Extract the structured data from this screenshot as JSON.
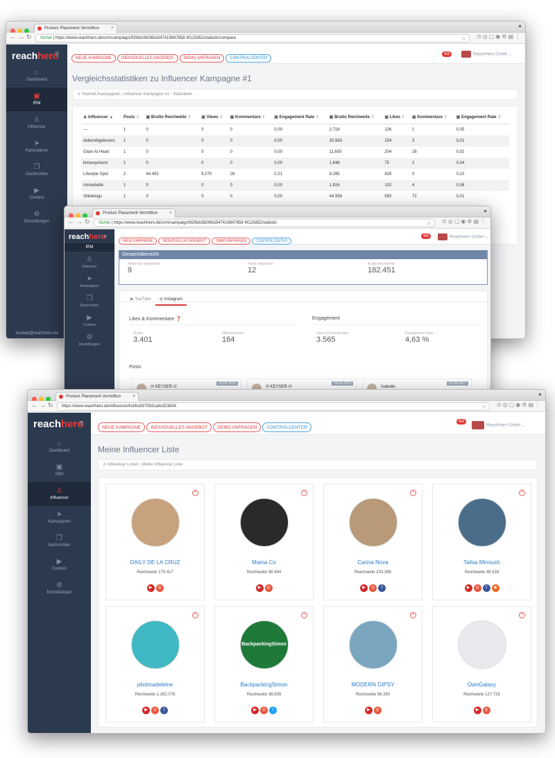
{
  "win1": {
    "tab_title": "Product Placement Vermittlun",
    "url_secure": "Sicher",
    "url": "https://www.reachhero.de/crm/campaign/92fddc5b065d347419847858 4f123d52/statistic/compare",
    "page_title": "Vergleichsstatistiken zu Influencer Kampagne #1",
    "breadcrumb": [
      "Statistik-Kampagnen",
      "Influencer Kampagne #1",
      "Statistiken"
    ],
    "sidebar": [
      {
        "label": "Dashboard",
        "icon": "home-icon"
      },
      {
        "label": "IRM",
        "icon": "briefcase-icon"
      },
      {
        "label": "Influencer",
        "icon": "user-icon"
      },
      {
        "label": "Kampagnen",
        "icon": "paper-plane-icon"
      },
      {
        "label": "Nachrichten",
        "icon": "chat-icon"
      },
      {
        "label": "Content",
        "icon": "video-icon"
      },
      {
        "label": "Einstellungen",
        "icon": "gear-icon"
      }
    ],
    "footer_email": "kontakt@reachhero.de",
    "table_headers": [
      "Influencer",
      "Posts",
      "Brutto Reichweite",
      "Views",
      "Kommentare",
      "Engagement Rate",
      "Brutto Reichweite",
      "Likes",
      "Kommentare",
      "Engagement Rate"
    ],
    "rows": [
      [
        "---",
        "1",
        "0",
        "0",
        "0",
        "0,00",
        "2.718",
        "126",
        "1",
        "0,05"
      ],
      [
        "deborahgebruers",
        "1",
        "0",
        "0",
        "0",
        "0,00",
        "20.563",
        "254",
        "3",
        "0,01"
      ],
      [
        "Glam At Heart",
        "1",
        "0",
        "0",
        "0",
        "0,00",
        "11.605",
        "204",
        "26",
        "0,02"
      ],
      [
        "kimwuyckens",
        "1",
        "0",
        "0",
        "0",
        "0,00",
        "1.846",
        "75",
        "2",
        "0,04"
      ],
      [
        "Lifestyle Spot",
        "2",
        "44.492",
        "9.270",
        "26",
        "0.21",
        "8.285",
        "828",
        "0",
        "0,10"
      ],
      [
        "minnebelle",
        "1",
        "0",
        "0",
        "0",
        "0,00",
        "1.816",
        "102",
        "4",
        "0,06"
      ],
      [
        "Silkeblogs",
        "1",
        "0",
        "0",
        "0",
        "0,00",
        "44.936",
        "593",
        "72",
        "0,01"
      ]
    ]
  },
  "common": {
    "pills": [
      "NEUE KAMPAGNE",
      "INDIVIDUELLES ANGEBOT",
      "DEMO ANFRAGEN",
      "CONTROLCENTER"
    ],
    "notif": "402",
    "account": "ReachHero GmbH",
    "brand_a": "reach",
    "brand_b": "hero"
  },
  "win2": {
    "tab_title": "Product Placement Vermittlun",
    "url_secure": "Sicher",
    "url": "https://www.reachhero.de/crm/campaign/92fddc5b065d347419847858 4f123d52/statistic",
    "sidebar_active": "IRM",
    "sidebar": [
      {
        "label": "Influencer",
        "icon": "user-icon"
      },
      {
        "label": "Kampagnen",
        "icon": "paper-plane-icon"
      },
      {
        "label": "Nachrichten",
        "icon": "chat-icon"
      },
      {
        "label": "Content",
        "icon": "video-icon"
      },
      {
        "label": "Einstellungen",
        "icon": "gear-icon"
      }
    ],
    "overview_title": "Gesamtübersicht",
    "overview_stats": [
      {
        "label": "Influencer eingesetzt",
        "value": "9"
      },
      {
        "label": "Posts eingesetzt",
        "value": "12"
      },
      {
        "label": "Brutto Reichweite",
        "value": "182.451"
      }
    ],
    "tabs": [
      "YouTube",
      "Instagram"
    ],
    "likes_title": "Likes & Kommentare",
    "engagement_title": "Engagement",
    "likes_stats": [
      {
        "label": "#Likes",
        "value": "3.401"
      },
      {
        "label": "#Kommentare",
        "value": "164"
      }
    ],
    "engagement_stats": [
      {
        "label": "Likes & Kommentare",
        "value": "3.565"
      },
      {
        "label": "Engagement Rate",
        "value": "4,63 %"
      }
    ],
    "posts_title": "Posts",
    "posts": [
      {
        "name": "/// KEYSER ///",
        "date": "19.05.2016"
      },
      {
        "name": "/// KEYSER ///",
        "date": "24.05.2016"
      },
      {
        "name": "Isabelle",
        "date": "13.06.2017"
      }
    ]
  },
  "win3": {
    "tab_title": "Product Placement Vermittlun",
    "url": "https://www.reachhero.de/influencer/list/bc837592cabc923834",
    "page_title": "Meine Influencer Liste",
    "breadcrumb": [
      "Influencer Listen",
      "Meine Influencer Liste"
    ],
    "sidebar": [
      {
        "label": "Dashboard",
        "icon": "home-icon"
      },
      {
        "label": "IRM",
        "icon": "briefcase-icon"
      },
      {
        "label": "Influencer",
        "icon": "user-icon"
      },
      {
        "label": "Kampagnen",
        "icon": "paper-plane-icon"
      },
      {
        "label": "Nachrichten",
        "icon": "chat-icon"
      },
      {
        "label": "Content",
        "icon": "video-icon"
      },
      {
        "label": "Einstellungen",
        "icon": "gear-icon"
      }
    ],
    "reach_label": "Reichweite",
    "cards": [
      {
        "name": "DAILY DE LA CRUZ",
        "reach": "175.417",
        "socials": [
          "youtube",
          "instagram"
        ],
        "color": "#c8a27c"
      },
      {
        "name": "Mama Co",
        "reach": "88.494",
        "socials": [
          "youtube",
          "instagram"
        ],
        "color": "#2a2a2a"
      },
      {
        "name": "Carina Nova",
        "reach": "233.288",
        "socials": [
          "youtube",
          "instagram",
          "facebook"
        ],
        "color": "#b89a78"
      },
      {
        "name": "Talisa Minoush",
        "reach": "49.918",
        "socials": [
          "youtube",
          "instagram",
          "facebook",
          "rss"
        ],
        "color": "#4a6e8a"
      },
      {
        "name": "pilotmadeleine",
        "reach": "1.262.078",
        "socials": [
          "youtube",
          "instagram",
          "facebook"
        ],
        "color": "#3fb8c4"
      },
      {
        "name": "BackpackingSimon",
        "reach": "38.839",
        "socials": [
          "youtube",
          "instagram",
          "twitter"
        ],
        "color": "#1f7a3a",
        "logo": "BackpackingSimon"
      },
      {
        "name": "MODERN GIPSY",
        "reach": "56.350",
        "socials": [
          "youtube",
          "instagram"
        ],
        "color": "#7aa6c0"
      },
      {
        "name": "OwnGalaxy",
        "reach": "127.725",
        "socials": [
          "youtube",
          "instagram"
        ],
        "color": "#e8eaee"
      }
    ]
  }
}
